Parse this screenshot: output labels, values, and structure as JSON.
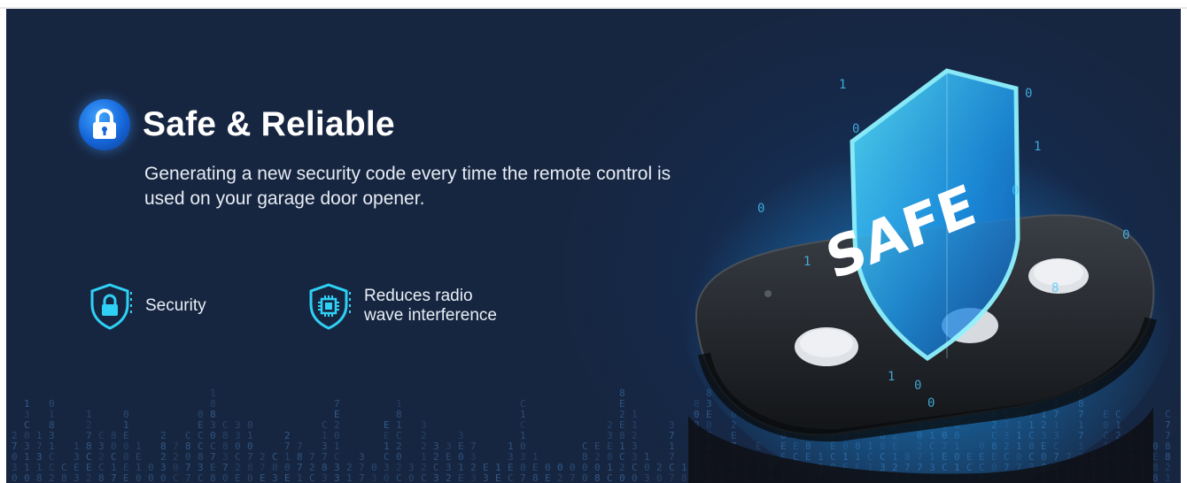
{
  "banner": {
    "title": "Safe & Reliable",
    "description": "Generating a new security code every time the remote control is used on your garage door opener.",
    "shield_text": "SAFE",
    "features": [
      {
        "icon": "shield-lock-icon",
        "label_lines": [
          "Security"
        ]
      },
      {
        "icon": "shield-chip-icon",
        "label_lines": [
          "Reduces radio",
          "wave interference"
        ]
      }
    ]
  },
  "colors": {
    "background": "#172640",
    "accent_cyan": "#2fd0f5",
    "lock_badge_blue": "#1f7bef",
    "text_white": "#ffffff"
  }
}
